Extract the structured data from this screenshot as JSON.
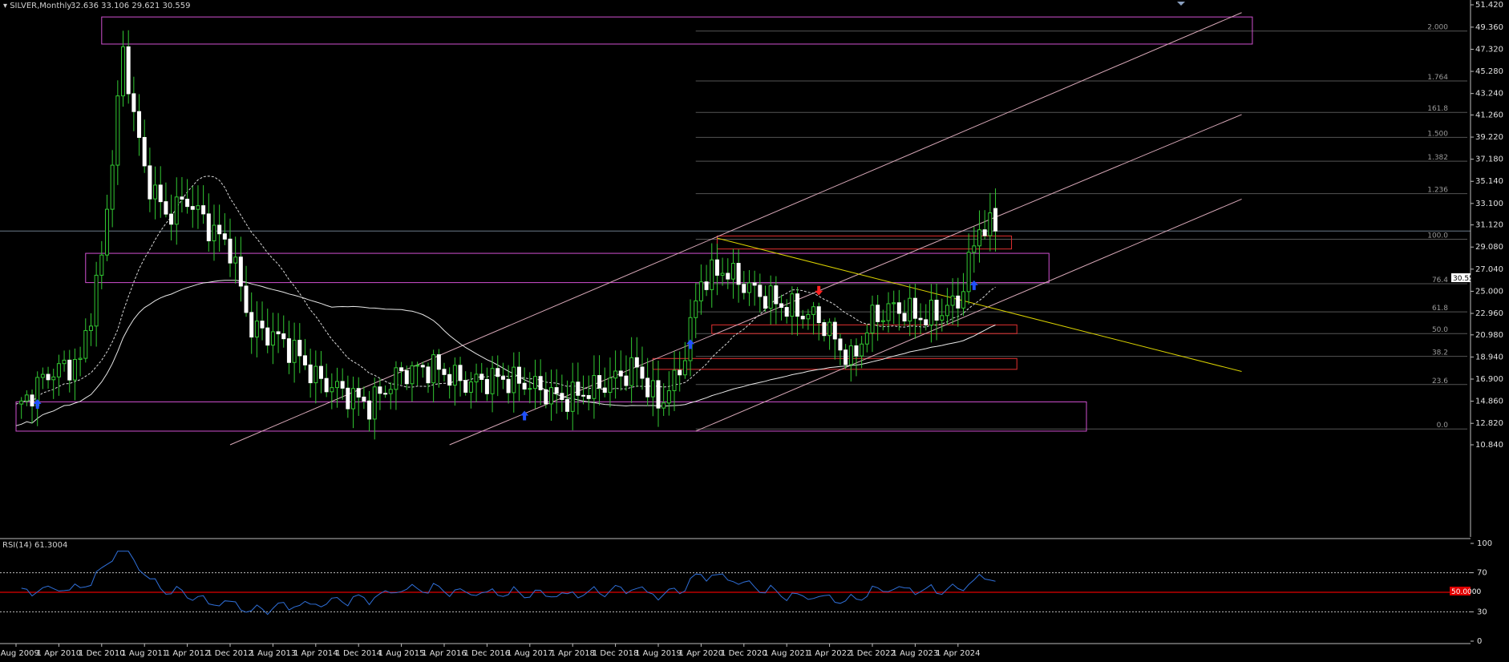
{
  "header": {
    "symbol": "SILVER,Monthly",
    "ohlc": "32.636 33.106 29.621 30.559"
  },
  "price_badge": "30.559",
  "rsi": {
    "label": "RSI(14) 61.3004",
    "badge": "50.0000",
    "levels": [
      100,
      70,
      30,
      0
    ],
    "level_labels": [
      "100",
      "70",
      "30",
      "0"
    ]
  },
  "price_axis_labels": [
    "51.420",
    "49.360",
    "47.320",
    "45.280",
    "43.240",
    "41.260",
    "39.220",
    "37.180",
    "35.140",
    "33.100",
    "31.120",
    "29.080",
    "27.040",
    "25.000",
    "22.960",
    "20.980",
    "18.940",
    "16.900",
    "14.860",
    "12.820",
    "10.840"
  ],
  "time_axis_labels": [
    "1 Aug 2009",
    "1 Apr 2010",
    "1 Dec 2010",
    "1 Aug 2011",
    "1 Apr 2012",
    "1 Dec 2012",
    "1 Aug 2013",
    "1 Apr 2014",
    "1 Dec 2014",
    "1 Aug 2015",
    "1 Apr 2016",
    "1 Dec 2016",
    "1 Aug 2017",
    "1 Apr 2018",
    "1 Dec 2018",
    "1 Aug 2019",
    "1 Apr 2020",
    "1 Dec 2020",
    "1 Aug 2021",
    "1 Apr 2022",
    "1 Dec 2022",
    "1 Aug 2023",
    "1 Apr 2024"
  ],
  "fib_labels": [
    {
      "text": "2.000",
      "value": 49.0
    },
    {
      "text": "1.764",
      "value": 44.4
    },
    {
      "text": "161.8",
      "value": 41.5
    },
    {
      "text": "1.500",
      "value": 39.2
    },
    {
      "text": "1.382",
      "value": 37.0
    },
    {
      "text": "1.236",
      "value": 34.0
    },
    {
      "text": "100.0",
      "value": 29.8
    },
    {
      "text": "76.4",
      "value": 25.7
    },
    {
      "text": "61.8",
      "value": 23.1
    },
    {
      "text": "50.0",
      "value": 21.1
    },
    {
      "text": "38.2",
      "value": 19.0
    },
    {
      "text": "23.6",
      "value": 16.4
    },
    {
      "text": "0.0",
      "value": 12.3
    }
  ],
  "colors": {
    "bull": "#32c832",
    "bear": "#ffffff",
    "grid": "#2a2a2a",
    "fib": "#555555",
    "channel": "#d8a8b8",
    "zone_magenta": "#d050d0",
    "zone_red": "#e03030",
    "trend_yellow": "#d8d000",
    "rsi_line": "#2f6fd8",
    "rsi_mid": "#e00000"
  },
  "chart_data": {
    "type": "candlestick",
    "title": "SILVER,Monthly",
    "x": [
      "1 Aug 2009",
      "1 Apr 2010",
      "1 Dec 2010",
      "1 Aug 2011",
      "1 Apr 2012",
      "1 Dec 2012",
      "1 Aug 2013",
      "1 Apr 2014",
      "1 Dec 2014",
      "1 Aug 2015",
      "1 Apr 2016",
      "1 Dec 2016",
      "1 Aug 2017",
      "1 Apr 2018",
      "1 Dec 2018",
      "1 Aug 2019",
      "1 Apr 2020",
      "1 Dec 2020",
      "1 Aug 2021",
      "1 Apr 2022",
      "1 Dec 2022",
      "1 Aug 2023",
      "1 Apr 2024"
    ],
    "close_approx": [
      14.0,
      17.4,
      29.5,
      39.5,
      32.5,
      31.3,
      21.5,
      19.7,
      16.0,
      14.5,
      17.5,
      16.0,
      17.0,
      16.4,
      15.5,
      18.0,
      15.0,
      25.5,
      25.5,
      22.8,
      23.9,
      24.3,
      26.5,
      30.6
    ],
    "ylim": [
      10.84,
      51.42
    ],
    "last": {
      "open": 32.636,
      "high": 33.106,
      "low": 29.621,
      "close": 30.559
    },
    "rsi_last": 61.3004,
    "rsi_ylim": [
      0,
      100
    ]
  }
}
